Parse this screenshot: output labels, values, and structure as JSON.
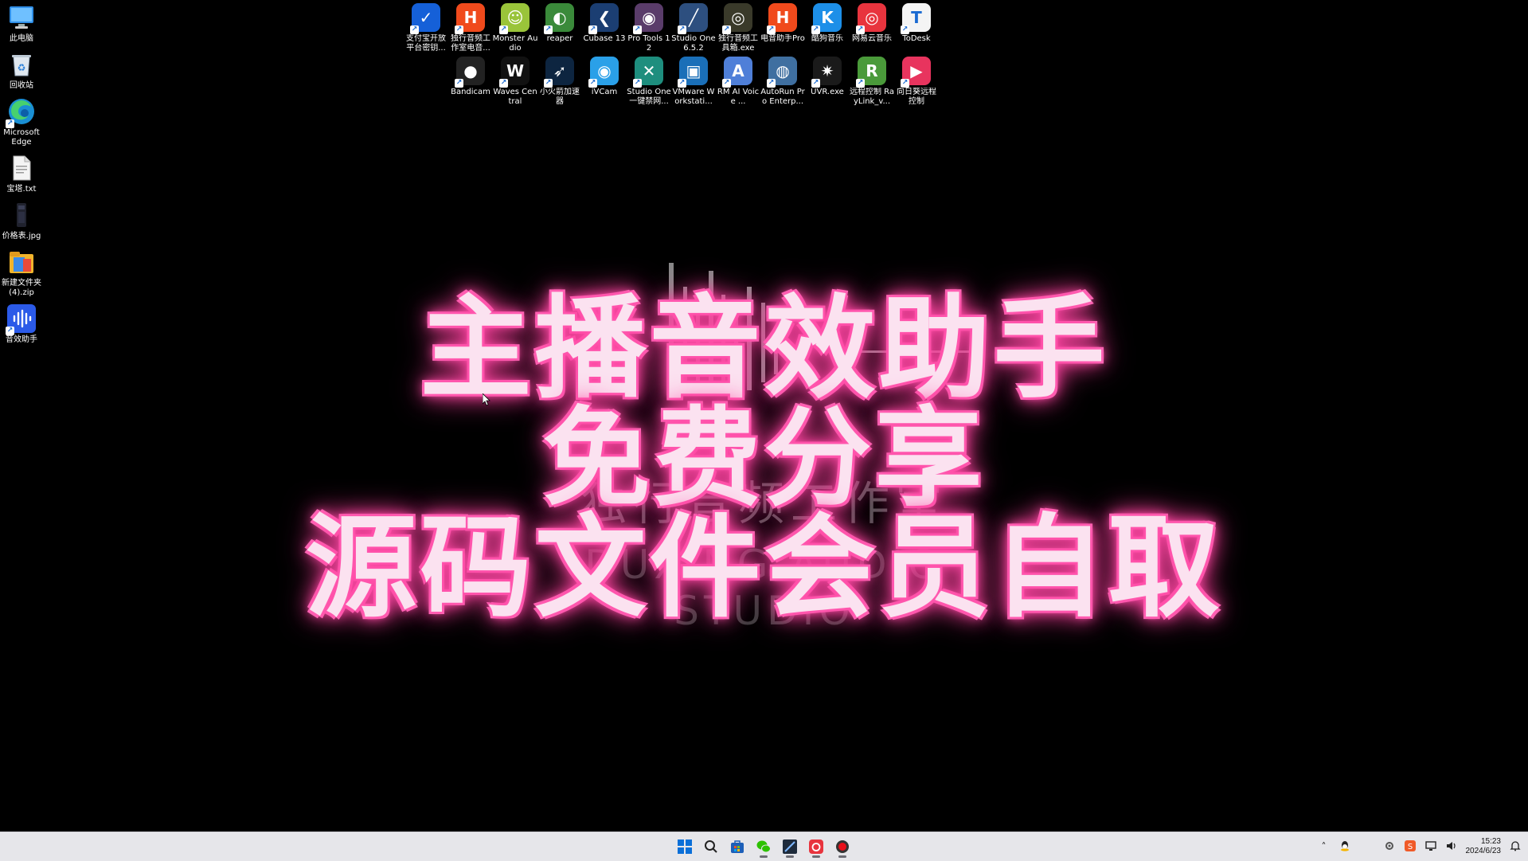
{
  "desktop_left": [
    {
      "label": "此电脑",
      "icon": "this-pc-icon",
      "color": "#2f8fe8"
    },
    {
      "label": "回收站",
      "icon": "recycle-bin-icon",
      "color": "#2a2a2a"
    },
    {
      "label": "Microsoft Edge",
      "icon": "edge-icon",
      "color": "#1a8fd3"
    },
    {
      "label": "宝塔.txt",
      "icon": "text-file-icon",
      "color": "#f2f2f2"
    },
    {
      "label": "价格表.jpg",
      "icon": "image-file-icon",
      "color": "#20222e"
    },
    {
      "label": "新建文件夹 (4).zip",
      "icon": "zip-folder-icon",
      "color": "#f0b42c"
    },
    {
      "label": "音效助手",
      "icon": "sound-assistant-icon",
      "color": "#2b5ae8"
    }
  ],
  "desktop_top": [
    {
      "label": "支付宝开放平台密钥...",
      "icon": "alipay-key-icon",
      "color": "#1560d8",
      "glyph": "✓"
    },
    {
      "label": "独行音频工作室电音...",
      "icon": "hop-audio-icon",
      "color": "#f04a1c",
      "glyph": "H"
    },
    {
      "label": "Monster Audio",
      "icon": "monster-audio-icon",
      "color": "#9ac43a",
      "glyph": "☺"
    },
    {
      "label": "reaper",
      "icon": "reaper-icon",
      "color": "#3a8a3a",
      "glyph": "◐"
    },
    {
      "label": "Cubase 13",
      "icon": "cubase-icon",
      "color": "#1b3e72",
      "glyph": "❮"
    },
    {
      "label": "Pro Tools 12",
      "icon": "pro-tools-icon",
      "color": "#5a3c6a",
      "glyph": "◉"
    },
    {
      "label": "Studio One 6.5.2",
      "icon": "studio-one-icon",
      "color": "#2d4f7f",
      "glyph": "╱"
    },
    {
      "label": "独行音频工具箱.exe",
      "icon": "toolbox-exe-icon",
      "color": "#3a3a2a",
      "glyph": "◎"
    },
    {
      "label": "电音助手Pro",
      "icon": "edm-assistant-icon",
      "color": "#f04a1c",
      "glyph": "H"
    },
    {
      "label": "酷狗音乐",
      "icon": "kugou-icon",
      "color": "#1d8fe8",
      "glyph": "K"
    },
    {
      "label": "网易云音乐",
      "icon": "netease-music-icon",
      "color": "#e8343e",
      "glyph": "◎"
    },
    {
      "label": "ToDesk",
      "icon": "todesk-icon",
      "color": "#f4f4f4",
      "glyph": "T"
    },
    {
      "label": "",
      "icon": "",
      "color": "",
      "glyph": ""
    },
    {
      "label": "Bandicam",
      "icon": "bandicam-icon",
      "color": "#222",
      "glyph": "●"
    },
    {
      "label": "Waves Central",
      "icon": "waves-icon",
      "color": "#111",
      "glyph": "W"
    },
    {
      "label": "小火箭加速器",
      "icon": "rocket-accelerator-icon",
      "color": "#0d2540",
      "glyph": "➶"
    },
    {
      "label": "iVCam",
      "icon": "ivcam-icon",
      "color": "#2aa0e8",
      "glyph": "◉"
    },
    {
      "label": "Studio One 一键禁网...",
      "icon": "studio-one-tool-icon",
      "color": "#1e8e7e",
      "glyph": "✕"
    },
    {
      "label": "VMware Workstati...",
      "icon": "vmware-icon",
      "color": "#1a6fb8",
      "glyph": "▣"
    },
    {
      "label": "RM AI Voice ...",
      "icon": "rm-ai-voice-icon",
      "color": "#4f7fd8",
      "glyph": "A"
    },
    {
      "label": "AutoRun Pro Enterp...",
      "icon": "autorun-icon",
      "color": "#3f6fa0",
      "glyph": "◍"
    },
    {
      "label": "UVR.exe",
      "icon": "uvr-icon",
      "color": "#1a1a1a",
      "glyph": "✷"
    },
    {
      "label": "远程控制 RayLink_v...",
      "icon": "raylink-icon",
      "color": "#4a9a3a",
      "glyph": "R"
    },
    {
      "label": "向日葵远程控制",
      "icon": "sunflower-remote-icon",
      "color": "#e8345e",
      "glyph": "▶"
    }
  ],
  "overlay": {
    "promo_line1": "主播音效助手",
    "promo_line2": "免费分享",
    "promo_line3": "源码文件会员自取",
    "background_text1": "独行音频工作室",
    "background_text2": "DUXING AUDIO STUDIO"
  },
  "taskbar": {
    "apps": [
      {
        "icon": "windows-start-icon",
        "active": false
      },
      {
        "icon": "search-icon",
        "active": false
      },
      {
        "icon": "store-icon",
        "active": false
      },
      {
        "icon": "wechat-icon",
        "active": true
      },
      {
        "icon": "studio-one-icon",
        "active": true
      },
      {
        "icon": "netease-music-icon",
        "active": true
      },
      {
        "icon": "bandicam-icon",
        "active": true
      }
    ],
    "time": "15:23",
    "date": "2024/6/23"
  },
  "colors": {
    "promo_glow": "#ff4fa8",
    "promo_fill": "#fbe2f0",
    "taskbar_bg": "#e6e6ea",
    "desktop_bg": "#000000"
  }
}
